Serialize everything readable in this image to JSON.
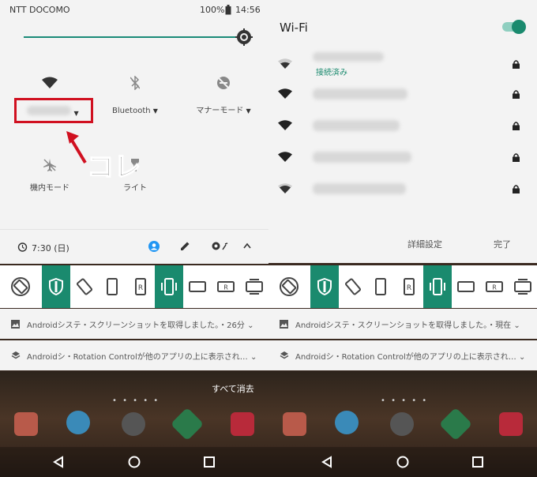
{
  "status": {
    "carrier": "NTT DOCOMO",
    "battery": "100%",
    "time": "14:56"
  },
  "tiles": [
    {
      "label": "",
      "icon": "wifi-icon"
    },
    {
      "label": "Bluetooth",
      "icon": "bluetooth-off-icon"
    },
    {
      "label": "マナーモード",
      "icon": "do-not-disturb-icon"
    },
    {
      "label": "機内モード",
      "icon": "airplane-icon"
    },
    {
      "label": "ライト",
      "icon": "flashlight-icon"
    }
  ],
  "annotation": {
    "text": "コレ"
  },
  "footer": {
    "alarm": "7:30 (日)"
  },
  "notifications": [
    {
      "text": "Androidシステ・スクリーンショットを取得しました。・26分 ⌄",
      "icon": "image-icon"
    },
    {
      "text": "Androidシ・Rotation Controlが他のアプリの上に表示され… ⌄",
      "icon": "layers-icon"
    }
  ],
  "clear_all": "すべて消去",
  "wifi_panel": {
    "title": "Wi-Fi",
    "connected": "接続済み",
    "detail_button": "詳細設定",
    "done_button": "完了"
  },
  "right_notifications": [
    {
      "text": "Androidシステ・スクリーンショットを取得しました。・現在 ⌄"
    },
    {
      "text": "Androidシ・Rotation Controlが他のアプリの上に表示され… ⌄"
    }
  ],
  "colors": {
    "accent": "#1a8a6e",
    "highlight": "#d01020"
  }
}
